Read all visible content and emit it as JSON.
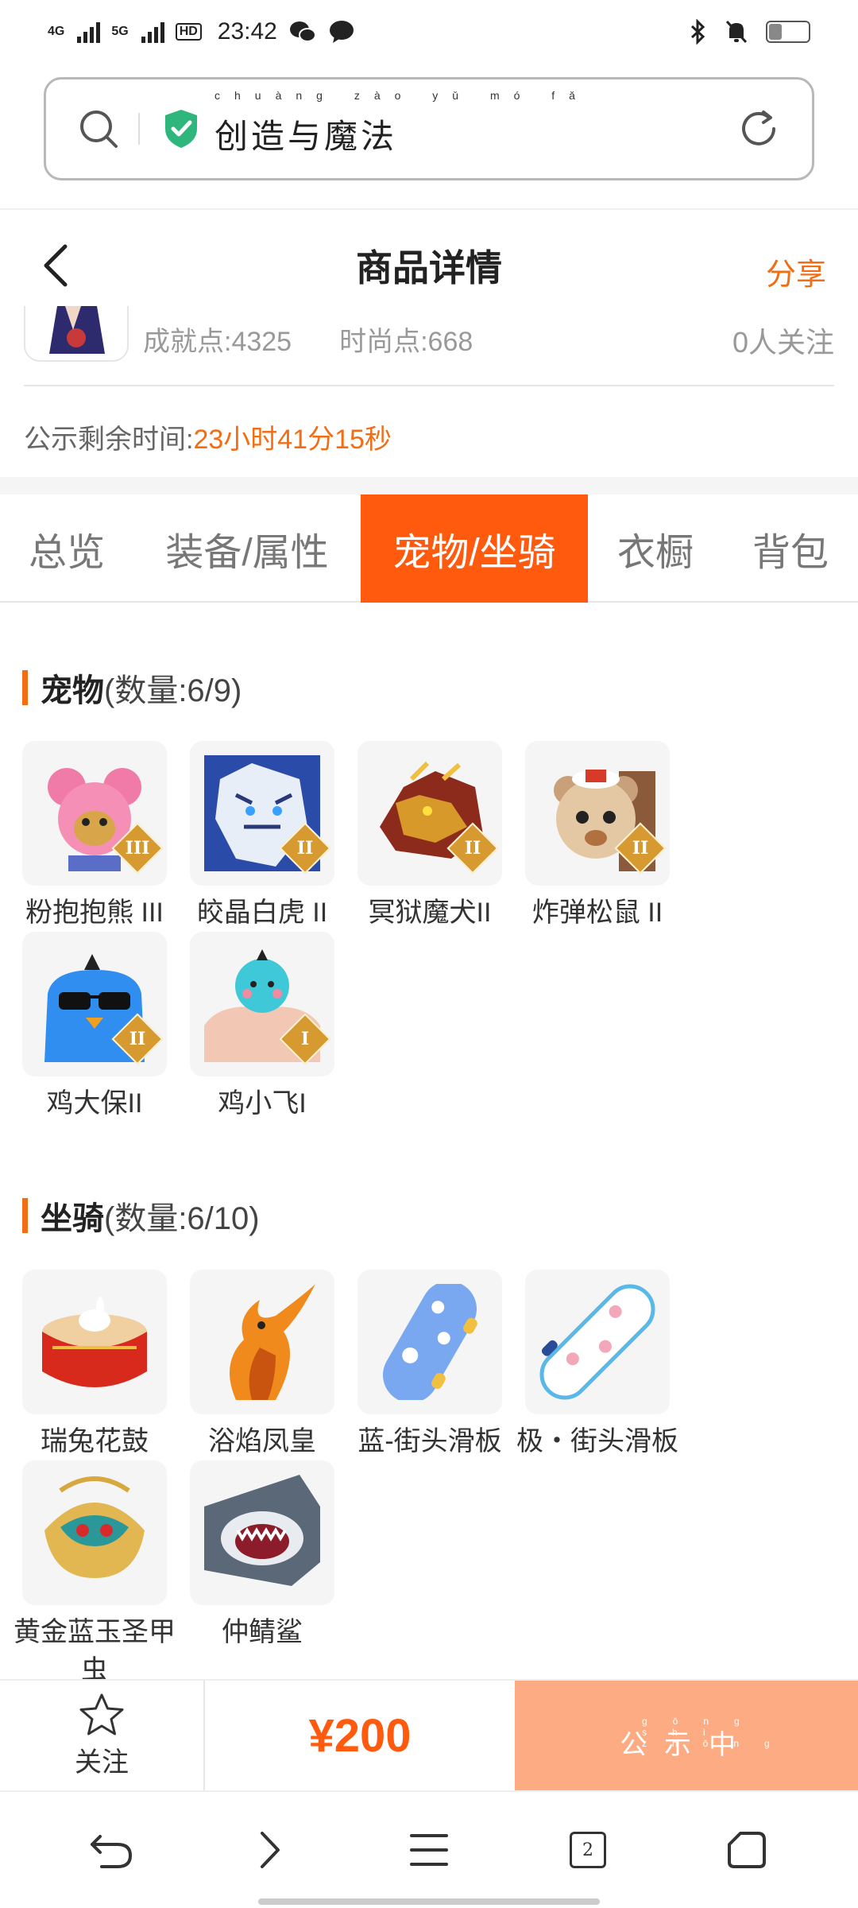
{
  "status_bar": {
    "network_1": "4G",
    "network_2": "5G",
    "hd_label": "HD",
    "time": "23:42",
    "battery": "30"
  },
  "search": {
    "text": "创造与魔法",
    "pinyin": "chuàng zào yǔ mó fǎ"
  },
  "header": {
    "title": "商品详情",
    "share": "分享"
  },
  "info": {
    "achievement": "成就点:4325",
    "fashion": "时尚点:668",
    "followers": "0人关注",
    "countdown_label": "公示剩余时间:",
    "countdown_value": "23小时41分15秒"
  },
  "tabs": [
    {
      "label": "总览",
      "active": false
    },
    {
      "label": "装备/属性",
      "active": false
    },
    {
      "label": "宠物/坐骑",
      "active": true
    },
    {
      "label": "衣橱",
      "active": false
    },
    {
      "label": "背包",
      "active": false
    }
  ],
  "pets": {
    "title": "宠物",
    "count": "(数量:6/9)",
    "items": [
      {
        "name": "粉抱抱熊 III",
        "tier": "III",
        "icon": "pink-bear-icon"
      },
      {
        "name": "皎晶白虎 II",
        "tier": "II",
        "icon": "white-tiger-icon"
      },
      {
        "name": "冥狱魔犬II",
        "tier": "II",
        "icon": "demon-dog-icon"
      },
      {
        "name": "炸弹松鼠 II",
        "tier": "II",
        "icon": "squirrel-icon"
      },
      {
        "name": "鸡大保II",
        "tier": "II",
        "icon": "blue-chicken-icon"
      },
      {
        "name": "鸡小飞I",
        "tier": "I",
        "icon": "small-chicken-icon"
      }
    ]
  },
  "mounts": {
    "title": "坐骑",
    "count": "(数量:6/10)",
    "items": [
      {
        "name": "瑞兔花鼓",
        "icon": "drum-icon"
      },
      {
        "name": "浴焰凤皇",
        "icon": "phoenix-icon"
      },
      {
        "name": "蓝-街头滑板",
        "icon": "skateboard-icon"
      },
      {
        "name": "极・街头滑板",
        "icon": "skateboard-icon"
      },
      {
        "name": "黄金蓝玉圣甲虫",
        "icon": "scarab-icon"
      },
      {
        "name": "仲鲭鲨",
        "icon": "shark-icon"
      }
    ]
  },
  "footer": {
    "follow_label": "关注",
    "price": "¥200",
    "status_label": "公示中",
    "status_pinyin": "gōng shì zhōng"
  },
  "navbar": {
    "tab_count": "2"
  },
  "colors": {
    "accent": "#ff5a0d",
    "accent_text": "#f26d14",
    "status_button": "#fcab82"
  }
}
